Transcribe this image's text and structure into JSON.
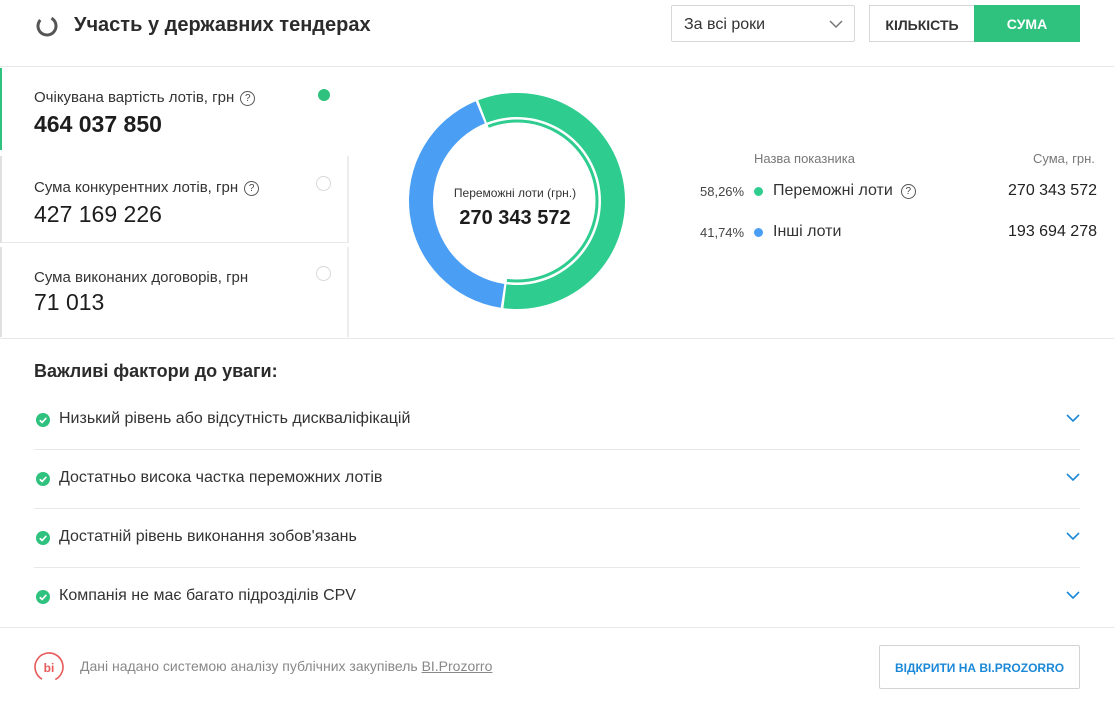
{
  "header": {
    "title": "Участь у державних тендерах",
    "period_select": "За всі роки",
    "toggle_count_label": "КІЛЬКІСТЬ",
    "toggle_sum_label": "СУМА",
    "active_toggle": "СУМА"
  },
  "metrics": [
    {
      "label": "Очікувана вартість лотів, грн",
      "value": "464 037 850",
      "active": true,
      "has_help": true
    },
    {
      "label": "Сума конкурентних лотів, грн",
      "value": "427 169 226",
      "active": false,
      "has_help": true
    },
    {
      "label": "Сума виконаних договорів, грн",
      "value": "71 013",
      "active": false,
      "has_help": false
    }
  ],
  "donut": {
    "center_label": "Переможні лоти (грн.)",
    "center_value": "270 343 572"
  },
  "chart_data": {
    "type": "pie",
    "categories": [
      "Переможні лоти",
      "Інші лоти"
    ],
    "values": [
      270343572,
      193694278
    ],
    "percentages": [
      58.26,
      41.74
    ],
    "colors": [
      "#2ecc8f",
      "#4a9ff5"
    ]
  },
  "legend": {
    "col_name": "Назва показника",
    "col_sum": "Сума, грн.",
    "rows": [
      {
        "pct": "58,26%",
        "name": "Переможні лоти",
        "value": "270 343 572",
        "color": "#2ecc8f",
        "has_help": true
      },
      {
        "pct": "41,74%",
        "name": "Інші лоти",
        "value": "193 694 278",
        "color": "#4a9ff5",
        "has_help": false
      }
    ]
  },
  "factors": {
    "title": "Важливі фактори до уваги:",
    "items": [
      "Низький рівень або відсутність дискваліфікацій",
      "Достатньо висока частка переможних лотів",
      "Достатній рівень виконання зобов'язань",
      "Компанія не має багато підрозділів CPV"
    ]
  },
  "footer": {
    "source_text": "Дані надано системою аналізу публічних закупівель",
    "source_link": "BI.Prozorro",
    "logo_text": "bi",
    "open_button": "ВІДКРИТИ НА BI.PROZORRO"
  },
  "colors": {
    "accent": "#2ec27e",
    "blue": "#4a9ff5",
    "link": "#1b88d8"
  },
  "icons": {
    "header": "loading-ring-icon",
    "help": "question-circle-icon",
    "factor_ok": "check-circle-icon",
    "expand": "chevron-down-icon",
    "footer_logo": "bi-logo-icon"
  }
}
